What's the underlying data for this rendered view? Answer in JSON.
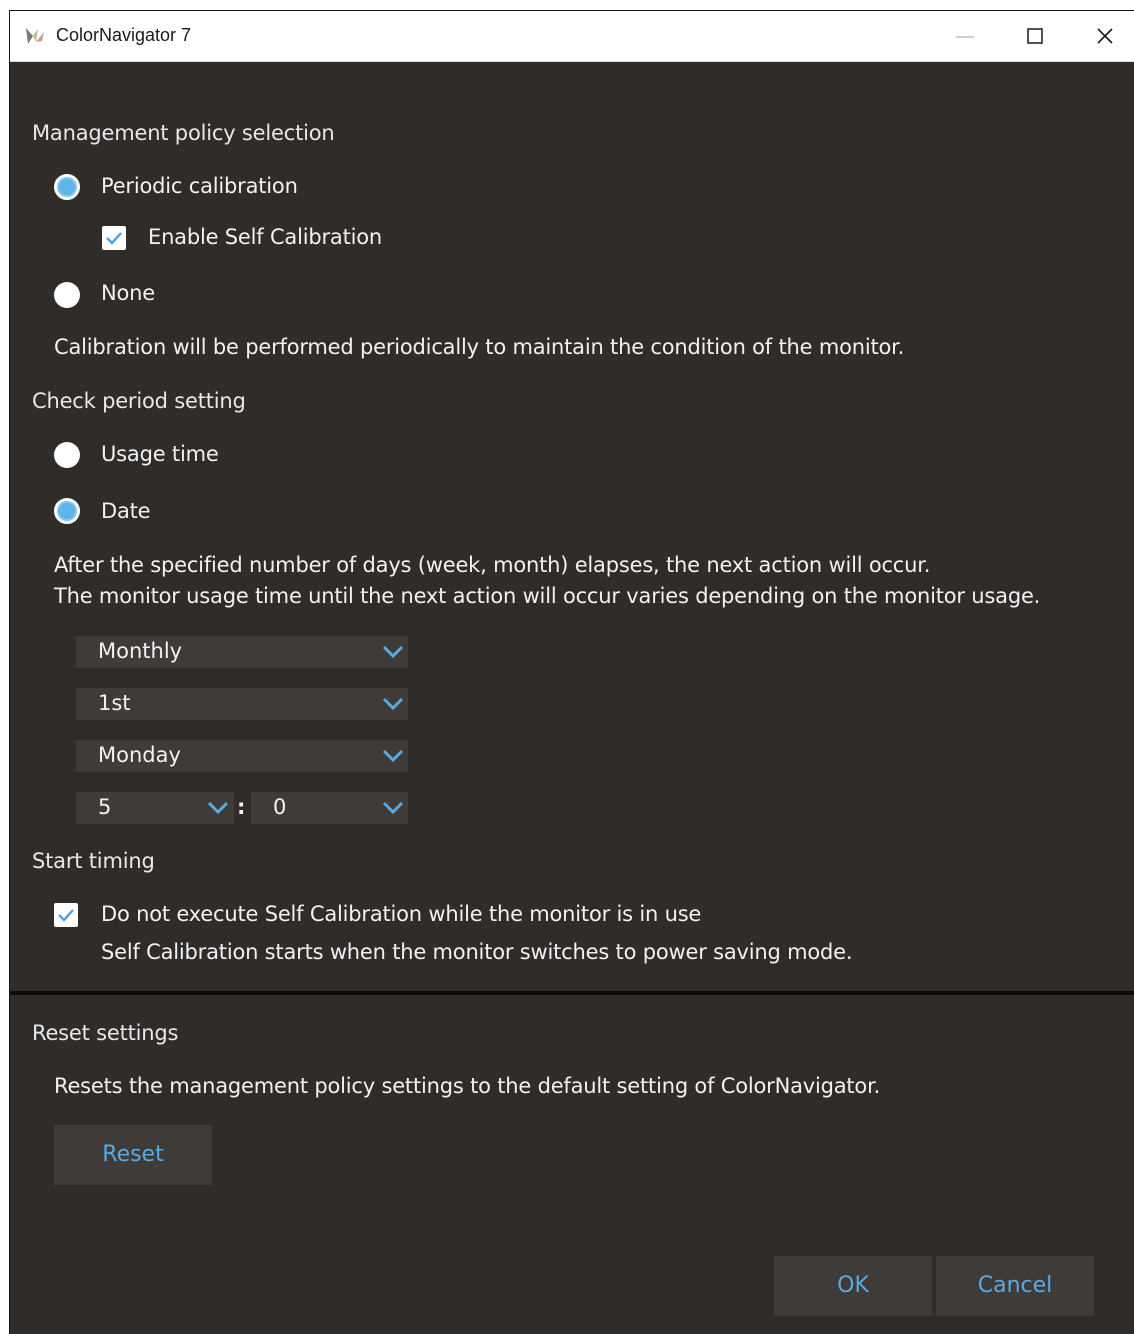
{
  "window": {
    "title": "ColorNavigator 7",
    "icon": "colornavigator-app-icon"
  },
  "policy": {
    "heading": "Management policy selection",
    "periodic_label": "Periodic calibration",
    "periodic_selected": true,
    "self_cal_label": "Enable Self Calibration",
    "self_cal_checked": true,
    "none_label": "None",
    "none_selected": false,
    "description": "Calibration will be performed periodically to maintain the condition of the monitor."
  },
  "check_period": {
    "heading": "Check period setting",
    "usage_label": "Usage time",
    "usage_selected": false,
    "date_label": "Date",
    "date_selected": true,
    "desc_line1": "After the specified number of days (week, month) elapses, the next action will occur.",
    "desc_line2": "The monitor usage time until the next action will occur varies depending on the monitor usage.",
    "frequency": "Monthly",
    "week_of_month": "1st",
    "weekday": "Monday",
    "hour": "5",
    "time_separator": ":",
    "minute": "0"
  },
  "start_timing": {
    "heading": "Start timing",
    "no_exec_label": "Do not execute Self Calibration while the monitor is in use",
    "no_exec_checked": true,
    "note": "Self Calibration starts when the monitor switches to power saving mode."
  },
  "reset": {
    "heading": "Reset settings",
    "description": "Resets the management policy settings to the default setting of ColorNavigator.",
    "button_label": "Reset"
  },
  "footer": {
    "ok_label": "OK",
    "cancel_label": "Cancel"
  },
  "colors": {
    "background": "#302c2a",
    "control_bg": "#3f3b39",
    "accent": "#5aa9e0",
    "radio_selected": "#5fb4e8"
  }
}
